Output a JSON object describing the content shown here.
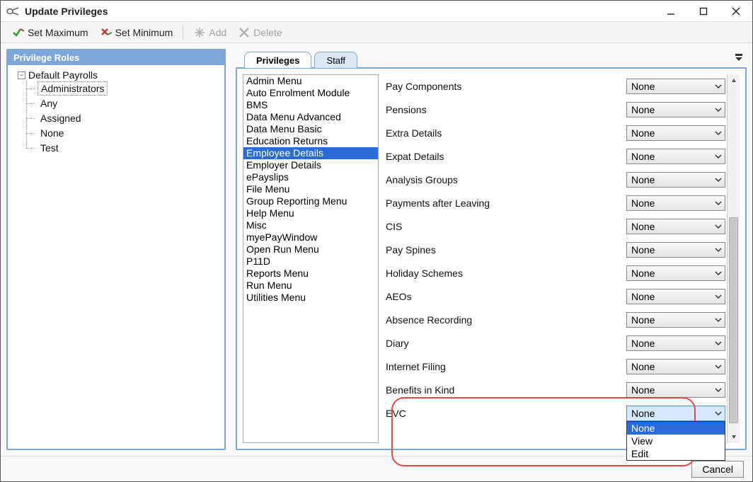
{
  "window": {
    "title": "Update Privileges"
  },
  "toolbar": {
    "set_max": "Set Maximum",
    "set_min": "Set Minimum",
    "add": "Add",
    "delete": "Delete"
  },
  "left": {
    "header": "Privilege Roles",
    "root": "Default Payrolls",
    "items": [
      "Administrators",
      "Any",
      "Assigned",
      "None",
      "Test"
    ],
    "selected_index": 0
  },
  "tabs": {
    "privileges": "Privileges",
    "staff": "Staff",
    "active": "privileges"
  },
  "categories": [
    "Admin Menu",
    "Auto Enrolment Module",
    "BMS",
    "Data Menu Advanced",
    "Data Menu Basic",
    "Education Returns",
    "Employee Details",
    "Employer Details",
    "ePayslips",
    "File Menu",
    "Group Reporting Menu",
    "Help Menu",
    "Misc",
    "myePayWindow",
    "Open Run Menu",
    "P11D",
    "Reports Menu",
    "Run Menu",
    "Utilities Menu"
  ],
  "categories_selected_index": 6,
  "rows": [
    {
      "label": "Pay Components",
      "value": "None"
    },
    {
      "label": "Pensions",
      "value": "None"
    },
    {
      "label": "Extra Details",
      "value": "None"
    },
    {
      "label": "Expat Details",
      "value": "None"
    },
    {
      "label": "Analysis Groups",
      "value": "None"
    },
    {
      "label": "Payments after Leaving",
      "value": "None"
    },
    {
      "label": "CIS",
      "value": "None"
    },
    {
      "label": "Pay Spines",
      "value": "None"
    },
    {
      "label": "Holiday Schemes",
      "value": "None"
    },
    {
      "label": "AEOs",
      "value": "None"
    },
    {
      "label": "Absence Recording",
      "value": "None"
    },
    {
      "label": "Diary",
      "value": "None"
    },
    {
      "label": "Internet Filing",
      "value": "None"
    },
    {
      "label": "Benefits in Kind",
      "value": "None"
    },
    {
      "label": "EVC",
      "value": "None"
    }
  ],
  "active_row_index": 14,
  "dropdown": {
    "open_for_row": 14,
    "options": [
      "None",
      "View",
      "Edit"
    ],
    "selected_index": 0
  },
  "footer": {
    "cancel": "Cancel"
  }
}
